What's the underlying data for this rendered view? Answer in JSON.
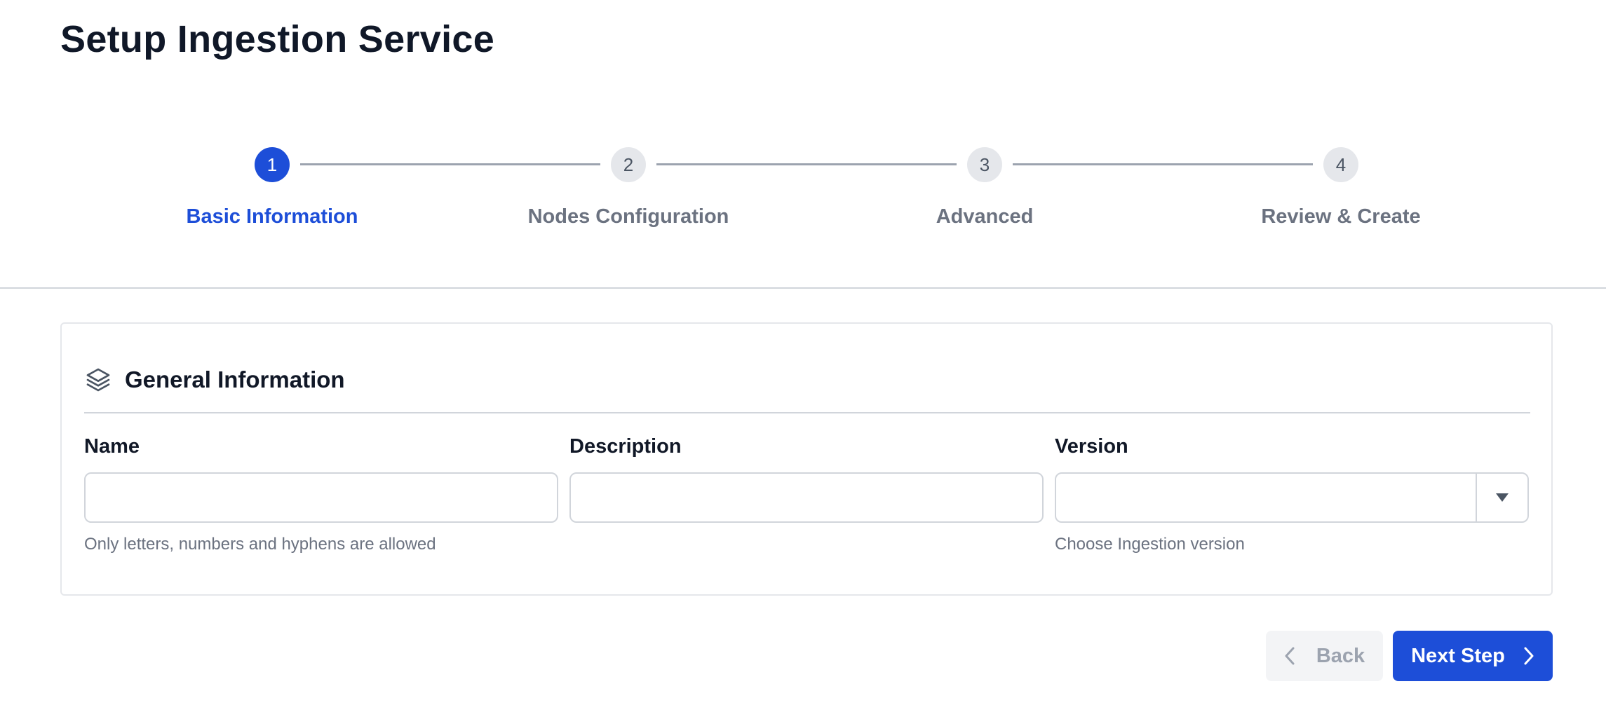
{
  "page": {
    "title": "Setup Ingestion Service"
  },
  "stepper": {
    "steps": [
      {
        "number": "1",
        "label": "Basic Information",
        "state": "active"
      },
      {
        "number": "2",
        "label": "Nodes Configuration",
        "state": "pending"
      },
      {
        "number": "3",
        "label": "Advanced",
        "state": "pending"
      },
      {
        "number": "4",
        "label": "Review & Create",
        "state": "pending"
      }
    ]
  },
  "card": {
    "icon": "layers-icon",
    "title": "General Information",
    "fields": {
      "name": {
        "label": "Name",
        "value": "",
        "placeholder": "",
        "help": "Only letters, numbers and hyphens are allowed"
      },
      "description": {
        "label": "Description",
        "value": "",
        "placeholder": ""
      },
      "version": {
        "label": "Version",
        "value": "",
        "toggle_icon": "caret-down-icon",
        "help": "Choose Ingestion version"
      }
    }
  },
  "actions": {
    "back_label": "Back",
    "back_icon": "chevron-left-icon",
    "next_label": "Next Step",
    "next_icon": "chevron-right-icon"
  },
  "colors": {
    "accent": "#1d4ed8",
    "muted_text": "#6b7280",
    "border": "#d1d5db",
    "disabled_bg": "#f3f4f6"
  }
}
